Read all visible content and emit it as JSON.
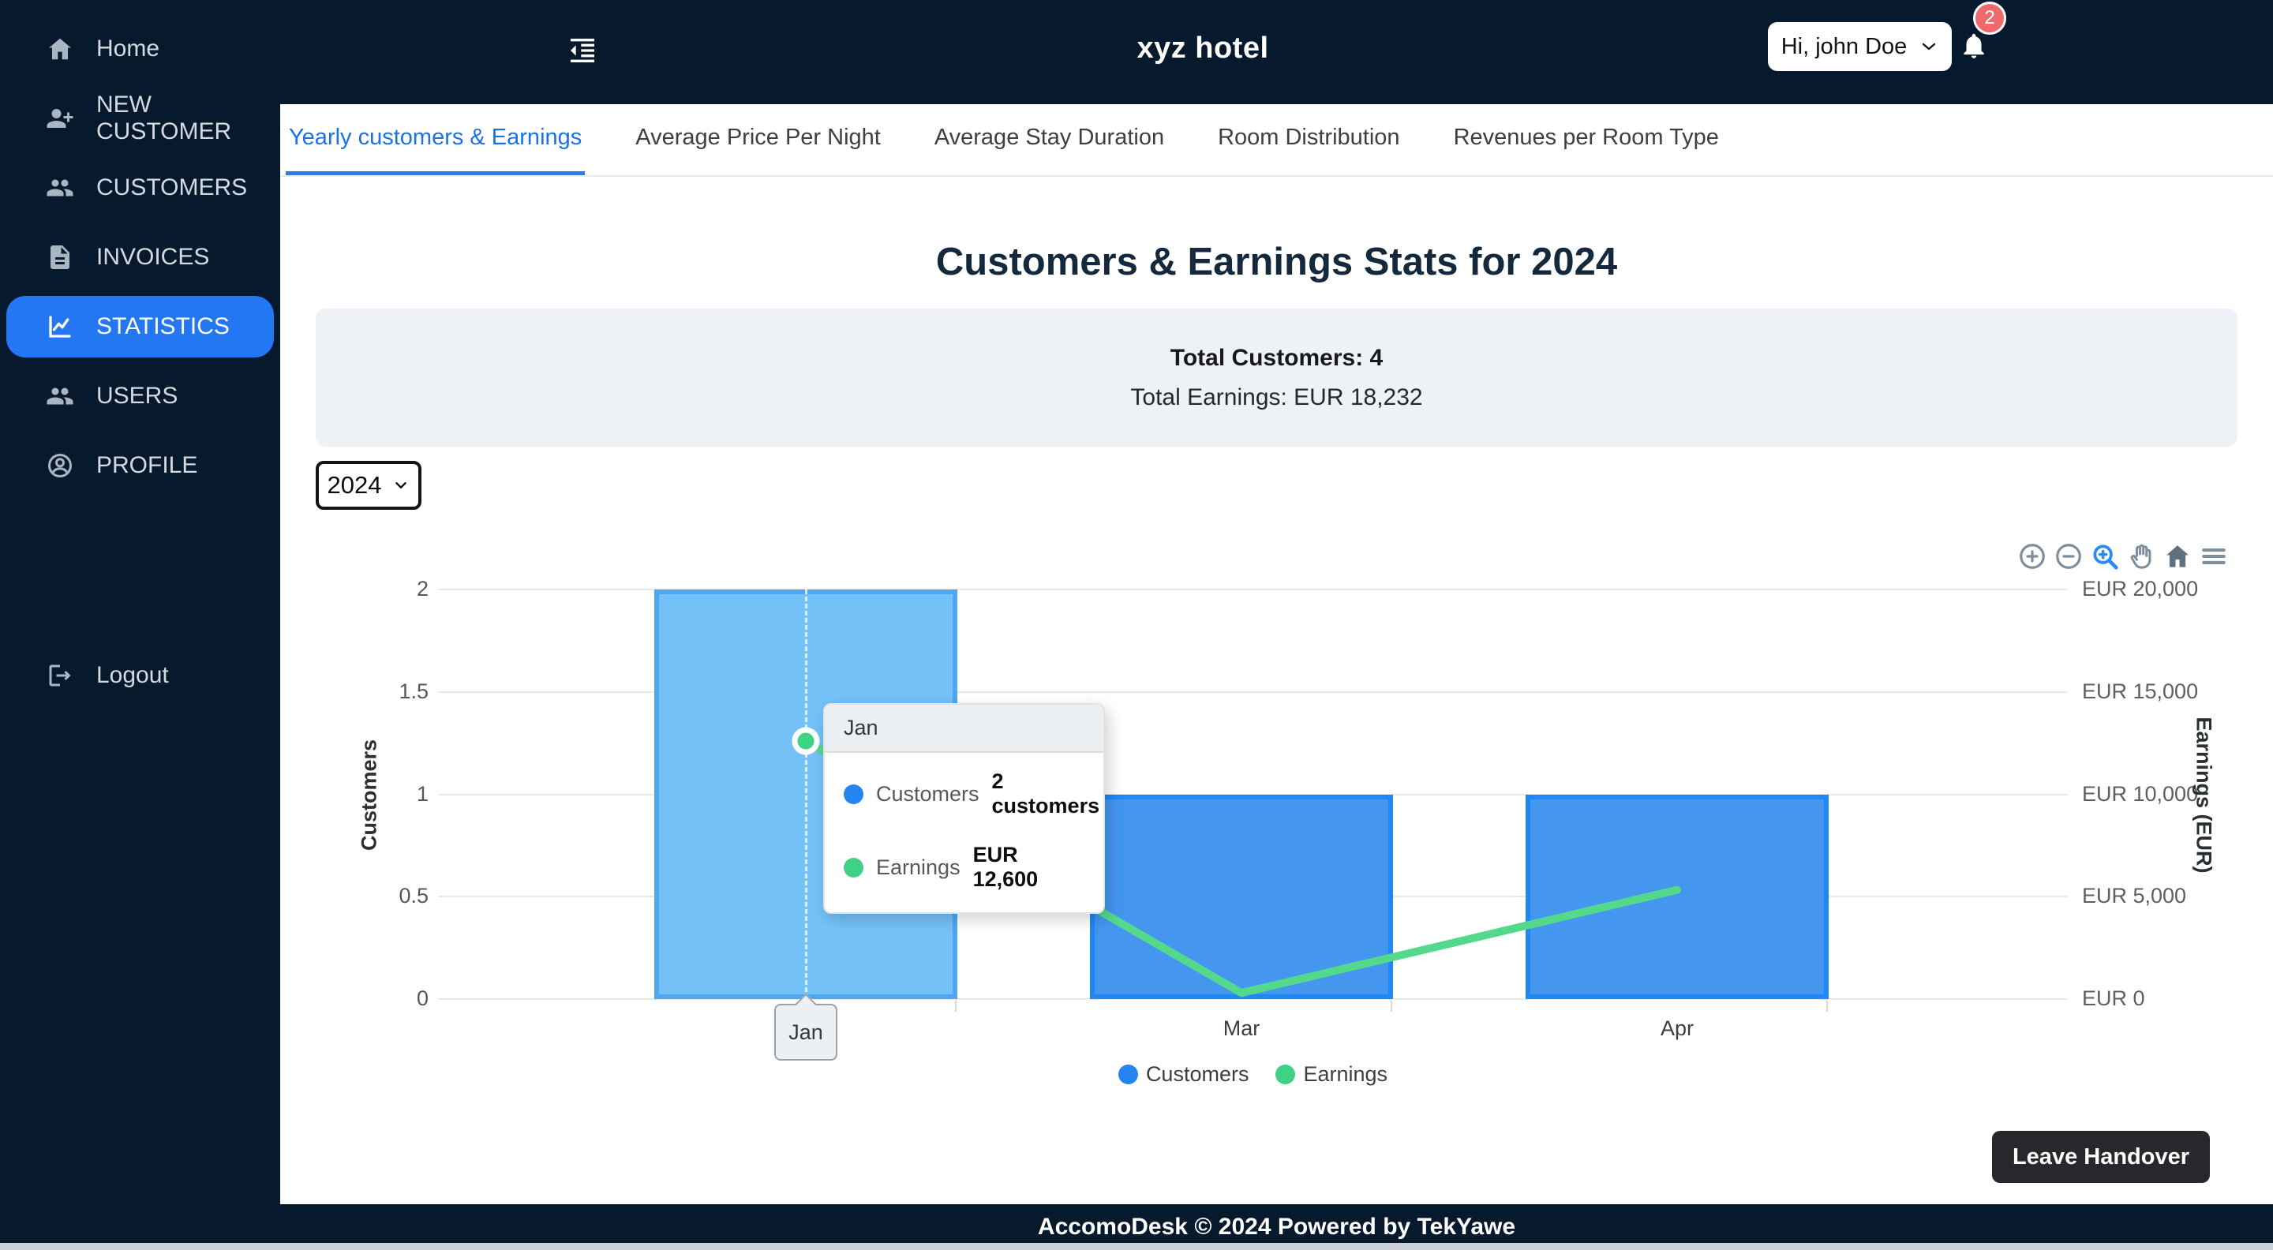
{
  "topbar": {
    "title": "xyz hotel",
    "user_button": "Hi, john Doe",
    "notification_count": "2"
  },
  "sidebar": {
    "items": [
      {
        "label": "Home",
        "icon": "home-icon"
      },
      {
        "label": "NEW CUSTOMER",
        "icon": "person-add-icon"
      },
      {
        "label": "CUSTOMERS",
        "icon": "people-icon"
      },
      {
        "label": "INVOICES",
        "icon": "invoice-icon"
      },
      {
        "label": "STATISTICS",
        "icon": "line-chart-icon",
        "active": true
      },
      {
        "label": "USERS",
        "icon": "users-icon"
      },
      {
        "label": "PROFILE",
        "icon": "profile-icon"
      }
    ],
    "logout_label": "Logout"
  },
  "tabs": [
    {
      "label": "Yearly customers & Earnings",
      "active": true
    },
    {
      "label": "Average Price Per Night"
    },
    {
      "label": "Average Stay Duration"
    },
    {
      "label": "Room Distribution"
    },
    {
      "label": "Revenues per Room Type"
    }
  ],
  "page": {
    "heading": "Customers & Earnings Stats for 2024",
    "total_customers": "Total Customers: 4",
    "total_earnings": "Total Earnings: EUR 18,232",
    "year_select_value": "2024",
    "leave_handover_label": "Leave Handover"
  },
  "chart_data": {
    "type": "bar+line",
    "categories": [
      "Jan",
      "Mar",
      "Apr"
    ],
    "series": [
      {
        "name": "Customers",
        "type": "bar",
        "axis": "left",
        "values": [
          2,
          1,
          1
        ],
        "unit": "customers"
      },
      {
        "name": "Earnings",
        "type": "line",
        "axis": "right",
        "values": [
          12600,
          300,
          5332
        ],
        "unit": "EUR"
      }
    ],
    "left_axis": {
      "title": "Customers",
      "min": 0,
      "max": 2,
      "ticks": [
        "2",
        "1.5",
        "1",
        "0.5",
        "0"
      ]
    },
    "right_axis": {
      "title": "Earnings (EUR)",
      "min": 0,
      "max": 20000,
      "ticks": [
        "EUR 20,000",
        "EUR 15,000",
        "EUR 10,000",
        "EUR 5,000",
        "EUR 0"
      ]
    },
    "legend": [
      "Customers",
      "Earnings"
    ],
    "legend_position": "bottom",
    "grid": true,
    "highlighted_index": 0
  },
  "tooltip": {
    "title": "Jan",
    "rows": [
      {
        "label": "Customers",
        "value": "2 customers"
      },
      {
        "label": "Earnings",
        "value": "EUR 12,600"
      }
    ]
  },
  "xaxis_tooltip": "Jan",
  "footer": "AccomoDesk © 2024 Powered by TekYawe",
  "colors": {
    "chrome_navy": "#071a2d",
    "accent_blue": "#2377f3",
    "bar": "#4496ef",
    "bar_border": "#1f88f6",
    "bar_highlight": "#74c1f8",
    "bar_highlight_border": "#4da7f3",
    "line": "#54d98c",
    "line_marker": "#3ed383",
    "customers_dot": "#2584f0",
    "earnings_dot": "#41d186",
    "badge_red": "#ee6a6c"
  }
}
